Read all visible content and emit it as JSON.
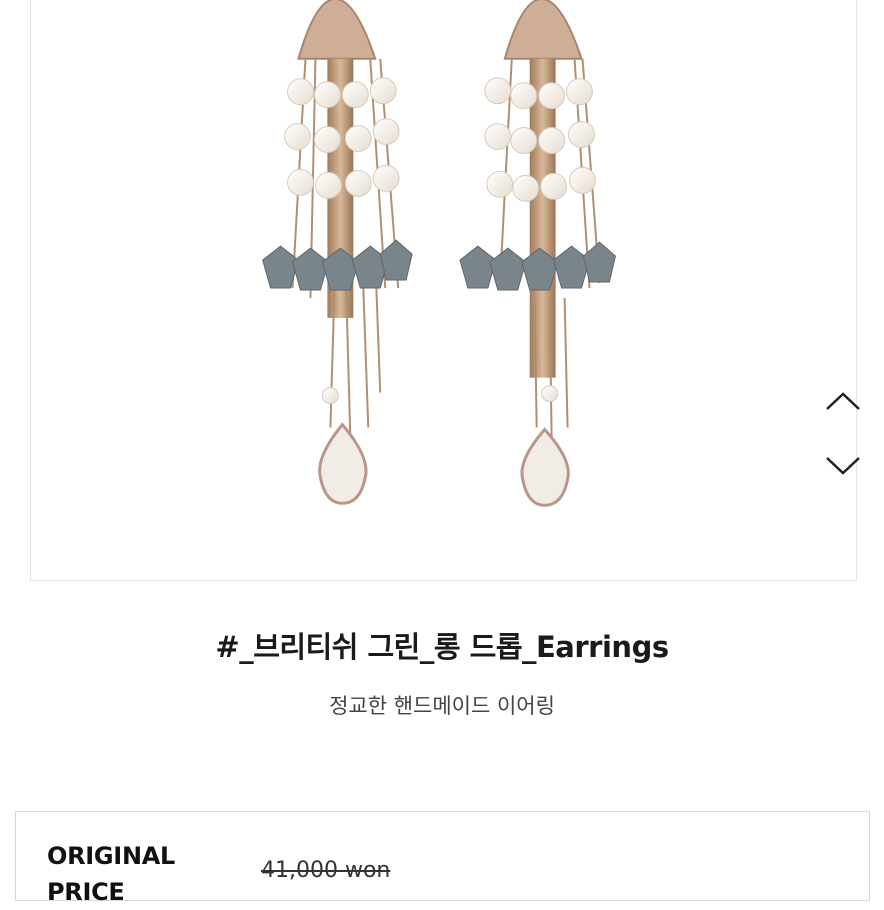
{
  "product": {
    "title": "#_브리티쉬 그린_롱 드롭_Earrings",
    "subtitle": "정교한 핸드메이드 이어링",
    "image_alt": "pearl and grey bead tassel drop earrings"
  },
  "gallery": {
    "up_icon": "chevron-up-icon",
    "down_icon": "chevron-down-icon"
  },
  "pricing": {
    "original_label": "ORIGINAL PRICE",
    "original_value": "41,000 won"
  }
}
